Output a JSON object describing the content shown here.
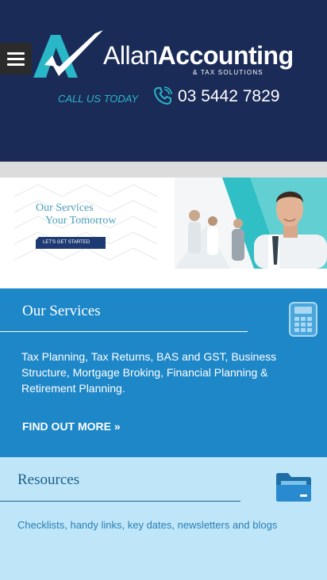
{
  "header": {
    "logo_light": "Allan",
    "logo_bold": "Accounting",
    "logo_sub": "& TAX SOLUTIONS",
    "call_label": "CALL US TODAY",
    "phone": "03 5442 7829",
    "icons": [
      "menu-icon",
      "logo-icon",
      "phone-icon"
    ],
    "colors": {
      "navy": "#1b2b58",
      "teal": "#29b6c6"
    }
  },
  "banner": {
    "line1": "Our Services",
    "line2": "Your Tomorrow",
    "button": "LET'S GET STARTED"
  },
  "services": {
    "title": "Our Services",
    "description": "Tax Planning, Tax Returns, BAS and GST, Business Structure, Mortgage Broking, Financial Planning & Retirement Planning.",
    "link": "FIND OUT MORE »",
    "icon": "calculator-icon",
    "color": "#1e87c8"
  },
  "resources": {
    "title": "Resources",
    "description": "Checklists, handy links, key dates, newsletters and blogs",
    "icon": "folder-icon",
    "color": "#bfe6f8"
  }
}
